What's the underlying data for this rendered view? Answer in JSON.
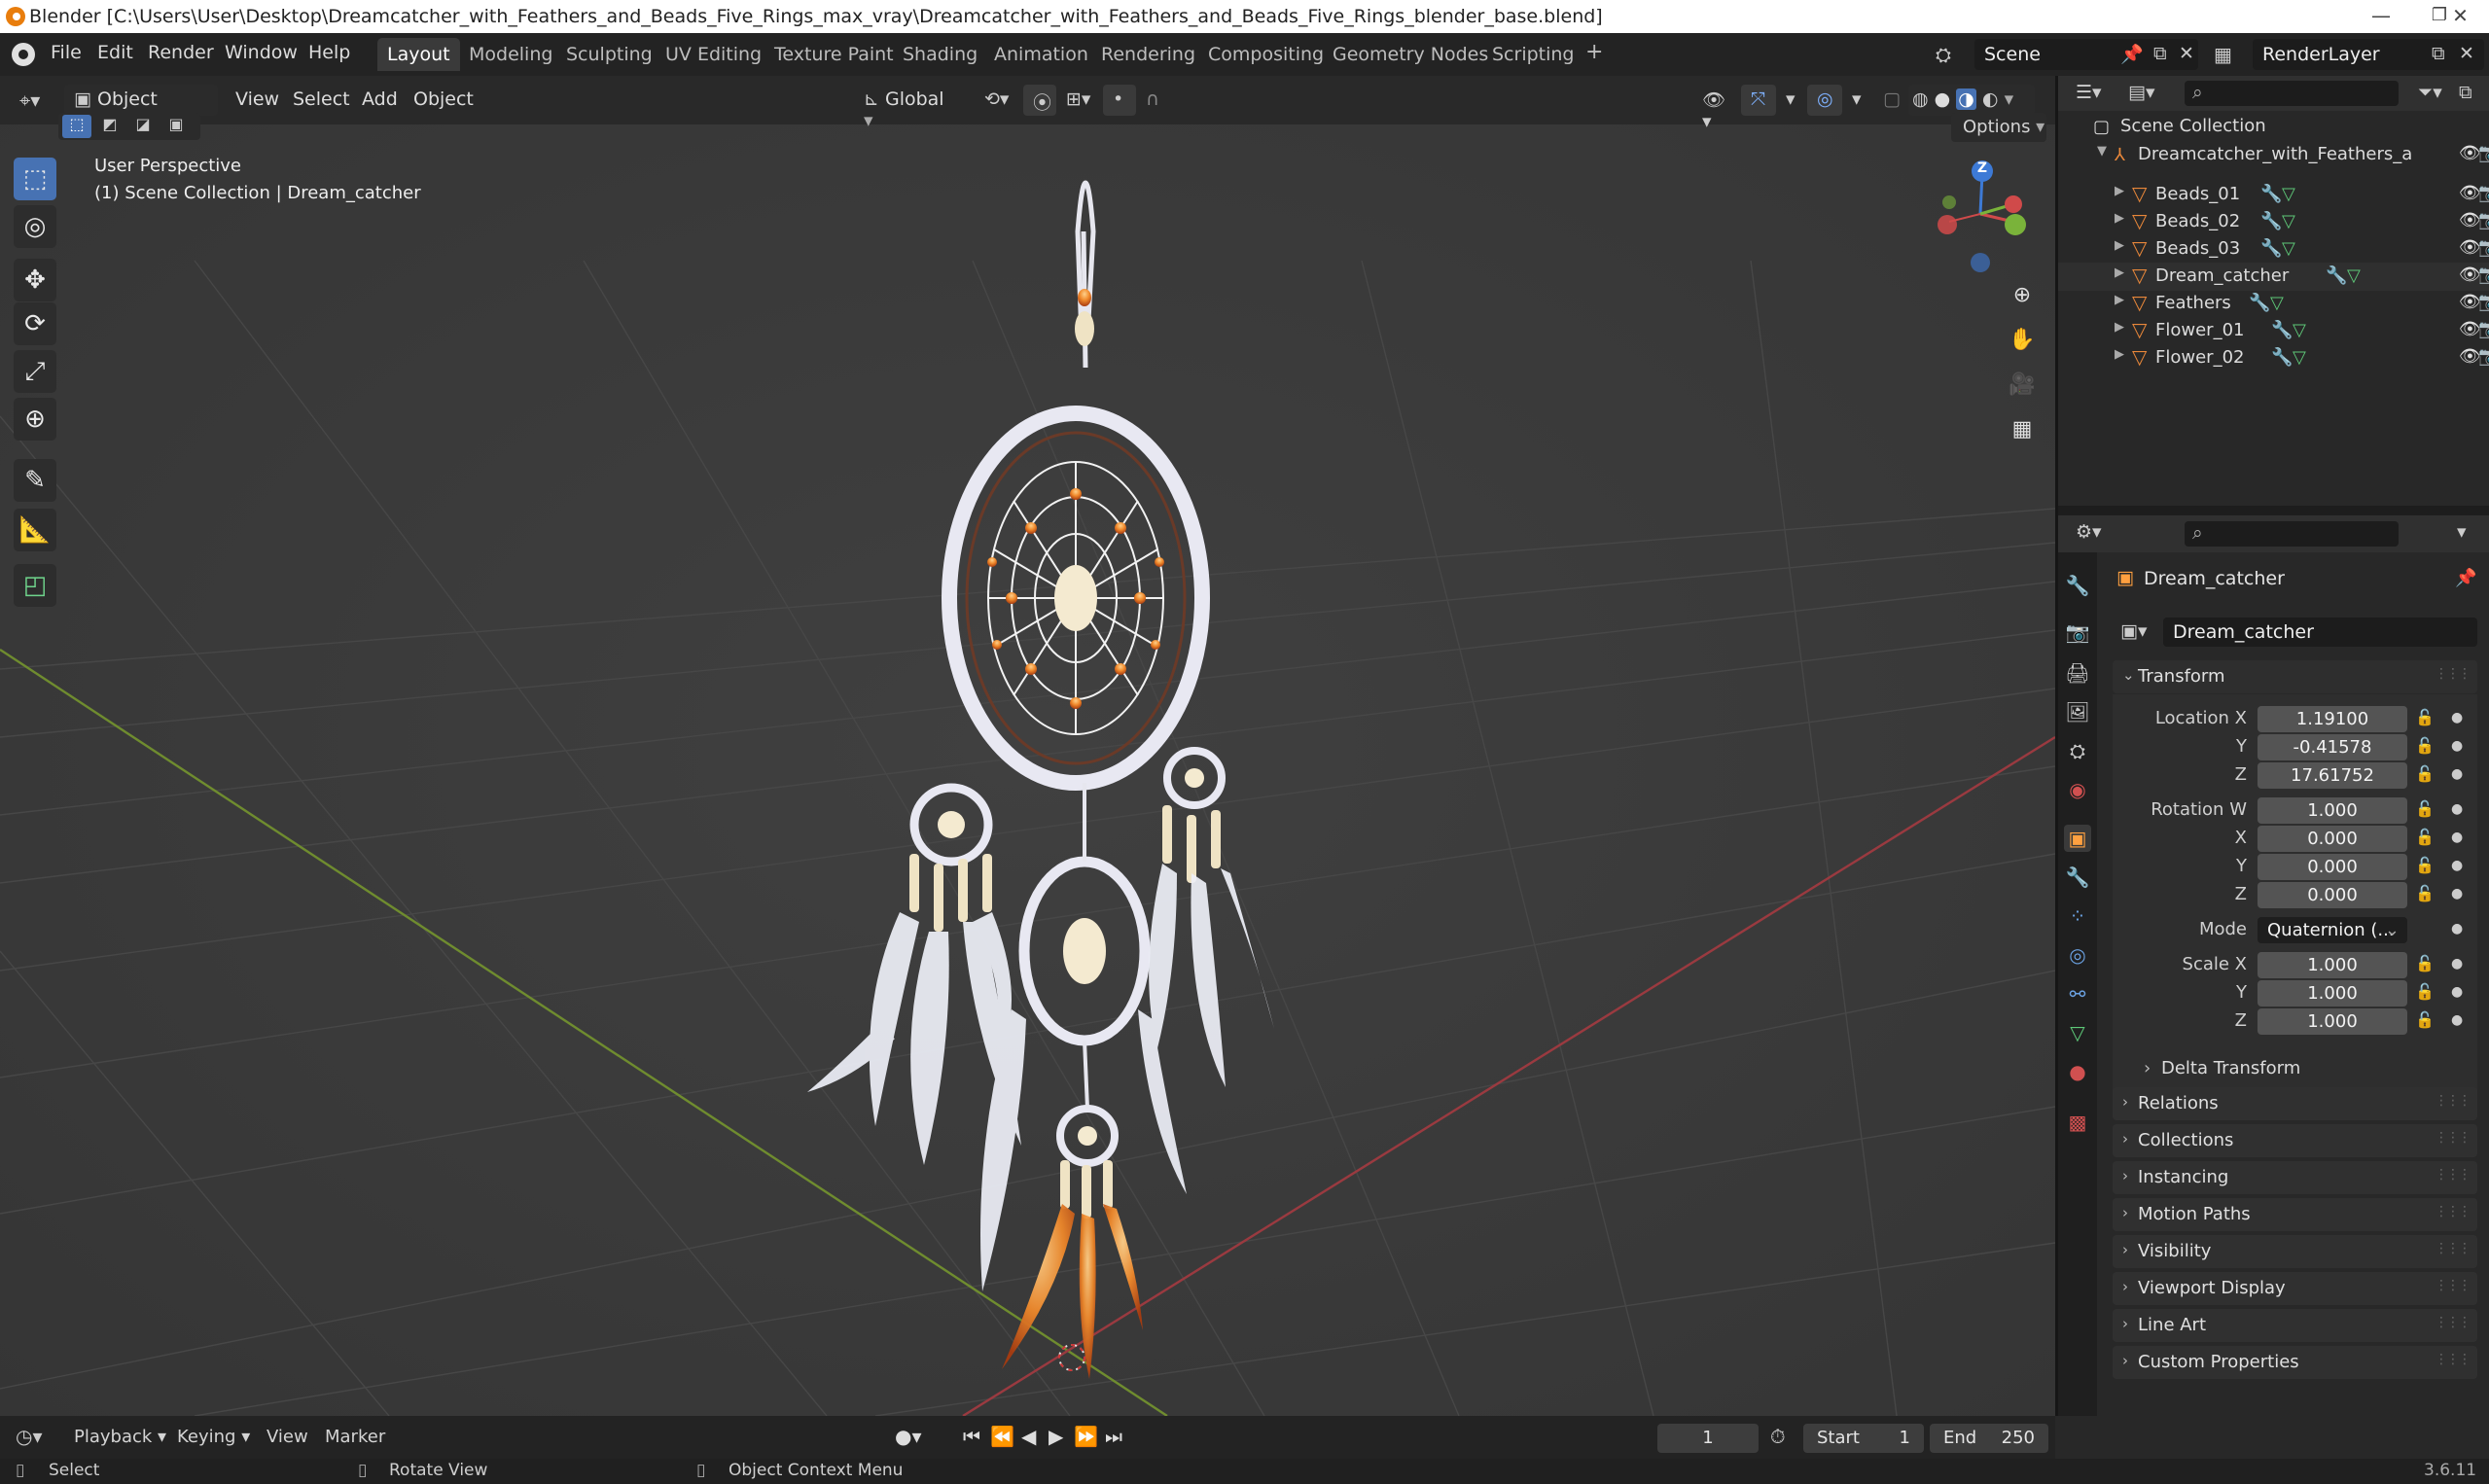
{
  "window": {
    "title": "Blender [C:\\Users\\User\\Desktop\\Dreamcatcher_with_Feathers_and_Beads_Five_Rings_max_vray\\Dreamcatcher_with_Feathers_and_Beads_Five_Rings_blender_base.blend]",
    "minimize": "—",
    "maximize": "❐",
    "close": "✕"
  },
  "menu": {
    "items": [
      "File",
      "Edit",
      "Render",
      "Window",
      "Help"
    ],
    "workspaces": [
      "Layout",
      "Modeling",
      "Sculpting",
      "UV Editing",
      "Texture Paint",
      "Shading",
      "Animation",
      "Rendering",
      "Compositing",
      "Geometry Nodes",
      "Scripting"
    ],
    "active_workspace": "Layout",
    "add_tab": "+",
    "scene": "Scene",
    "render_layer": "RenderLayer"
  },
  "viewport_header": {
    "mode": "Object Mode",
    "menus": [
      "View",
      "Select",
      "Add",
      "Object"
    ],
    "orientation": "Global",
    "options": "Options"
  },
  "viewport": {
    "perspective": "User Perspective",
    "collection_info": "(1) Scene Collection | Dream_catcher",
    "gizmo_z": "Z"
  },
  "outliner": {
    "root": "Scene Collection",
    "collection": "Dreamcatcher_with_Feathers_a",
    "objects": [
      "Beads_01",
      "Beads_02",
      "Beads_03",
      "Dream_catcher",
      "Feathers",
      "Flower_01",
      "Flower_02"
    ]
  },
  "properties": {
    "object_name": "Dream_catcher",
    "datablock_name": "Dream_catcher",
    "transform_title": "Transform",
    "location_label": "Location X",
    "location": {
      "x": "1.19100",
      "y": "-0.41578",
      "z": "17.61752"
    },
    "rotation_label": "Rotation W",
    "rotation": {
      "w": "1.000",
      "x": "0.000",
      "y": "0.000",
      "z": "0.000"
    },
    "mode_label": "Mode",
    "mode_value": "Quaternion (...",
    "scale_label": "Scale X",
    "scale": {
      "x": "1.000",
      "y": "1.000",
      "z": "1.000"
    },
    "axis_y": "Y",
    "axis_z": "Z",
    "axis_x": "X",
    "delta_transform": "Delta Transform",
    "panels": [
      "Relations",
      "Collections",
      "Instancing",
      "Motion Paths",
      "Visibility",
      "Viewport Display",
      "Line Art",
      "Custom Properties"
    ]
  },
  "timeline": {
    "menus": [
      "Playback",
      "Keying",
      "View",
      "Marker"
    ],
    "current_frame": "1",
    "start_label": "Start",
    "start": "1",
    "end_label": "End",
    "end": "250"
  },
  "status": {
    "select": "Select",
    "rotate": "Rotate View",
    "context": "Object Context Menu",
    "version": "3.6.11"
  },
  "colors": {
    "accent": "#4772b3",
    "mesh_icon": "#5ec878",
    "object_icon": "#e8873a",
    "x_axis": "#d04a4a",
    "y_axis": "#7ab33a",
    "z_axis": "#3d7ad6"
  }
}
